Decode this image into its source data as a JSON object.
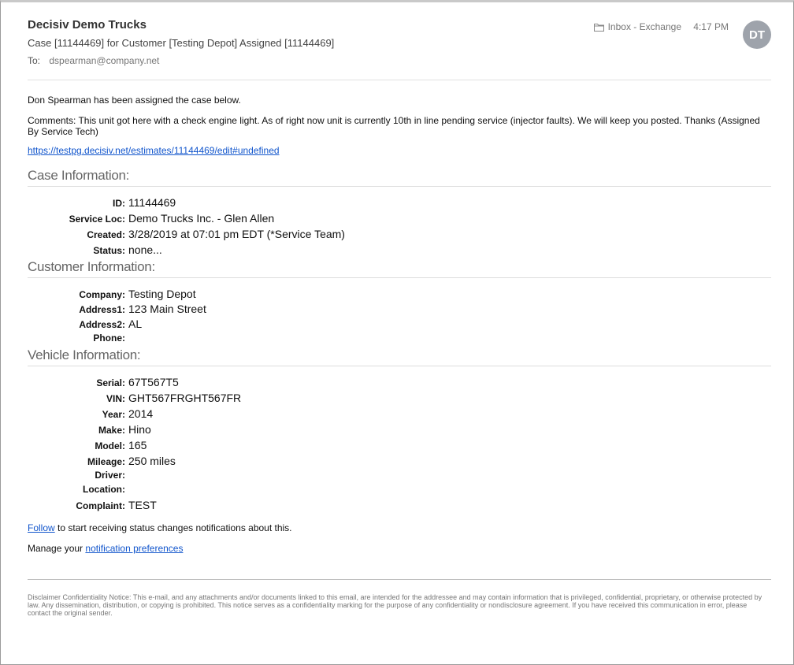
{
  "header": {
    "sender": "Decisiv Demo Trucks",
    "subject": "Case [11144469] for Customer [Testing Depot] Assigned [11144469]",
    "to_label": "To:",
    "to_address": "dspearman@company.net",
    "folder": "Inbox - Exchange",
    "time": "4:17 PM",
    "avatar_initials": "DT"
  },
  "body": {
    "assigned_name": "Don Spearman",
    "assigned_text": " has been assigned the case below.",
    "comments": "Comments: This unit got here with a check engine light. As of right now unit is currently 10th in line pending service (injector faults). We will keep you posted. Thanks (Assigned By Service Tech)",
    "case_link": "https://testpg.decisiv.net/estimates/11144469/edit#undefined"
  },
  "case_info": {
    "title": "Case Information:",
    "fields": [
      {
        "label": "ID:",
        "value": "11144469"
      },
      {
        "label": "Service Loc:",
        "value": "Demo Trucks Inc. - Glen Allen"
      },
      {
        "label": "Created:",
        "value": "3/28/2019 at 07:01 pm EDT (*Service Team)"
      },
      {
        "label": "Status:",
        "value": "none..."
      }
    ]
  },
  "customer_info": {
    "title": "Customer Information:",
    "fields": [
      {
        "label": "Company:",
        "value": "Testing Depot"
      },
      {
        "label": "Address1:",
        "value": "123 Main Street"
      },
      {
        "label": "Address2:",
        "value": "AL"
      },
      {
        "label": "Phone:",
        "value": ""
      }
    ]
  },
  "vehicle_info": {
    "title": "Vehicle Information:",
    "fields": [
      {
        "label": "Serial:",
        "value": "67T567T5"
      },
      {
        "label": "VIN:",
        "value": "GHT567FRGHT567FR"
      },
      {
        "label": "Year:",
        "value": "2014"
      },
      {
        "label": "Make:",
        "value": "Hino"
      },
      {
        "label": "Model:",
        "value": "165"
      },
      {
        "label": "Mileage:",
        "value": "250 miles"
      },
      {
        "label": "Driver:",
        "value": ""
      },
      {
        "label": "Location:",
        "value": ""
      },
      {
        "label": "Complaint:",
        "value": "TEST"
      }
    ]
  },
  "footer": {
    "follow_link": "Follow",
    "follow_text": " to start receiving status changes notifications about this.",
    "manage_text": "Manage your ",
    "manage_link": "notification preferences",
    "disclaimer": "Disclaimer Confidentiality Notice: This e-mail, and any attachments and/or documents linked to this email, are intended for the addressee and may contain information that is privileged, confidential, proprietary, or otherwise protected by law. Any dissemination, distribution, or copying is prohibited. This notice serves as a confidentiality marking for the purpose of any confidentiality or nondisclosure agreement. If you have received this communication in error, please contact the original sender."
  },
  "colors": {
    "link": "#1155cc",
    "avatar_bg": "#9ea3ab",
    "section_title": "#666666"
  }
}
